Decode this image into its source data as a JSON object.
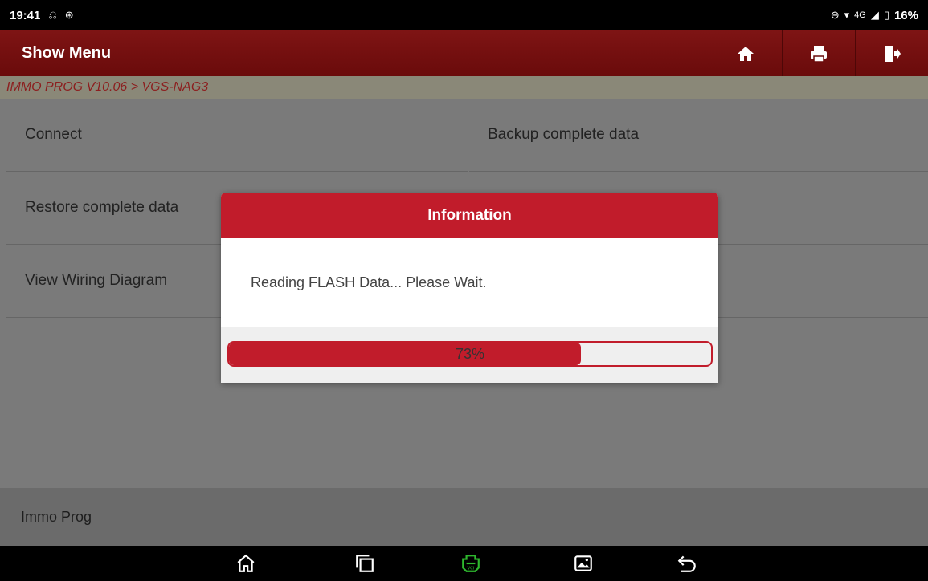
{
  "status_bar": {
    "time": "19:41",
    "network": "4G",
    "battery": "16%"
  },
  "header": {
    "title": "Show Menu",
    "buttons": [
      {
        "icon": "home-icon"
      },
      {
        "icon": "print-icon"
      },
      {
        "icon": "exit-icon"
      }
    ]
  },
  "breadcrumb": "IMMO PROG V10.06 > VGS-NAG3",
  "menu": {
    "items": [
      {
        "label": "Connect"
      },
      {
        "label": "Backup complete data"
      },
      {
        "label": "Restore complete data"
      },
      {
        "label": "View Wiring Diagram"
      }
    ]
  },
  "footer": {
    "label": "Immo Prog"
  },
  "dialog": {
    "title": "Information",
    "message": "Reading FLASH Data... Please Wait.",
    "progress_text": "73%",
    "progress_fraction": 0.73
  },
  "navbar": {
    "icons": [
      "home-icon",
      "recents-icon",
      "vci-icon",
      "screenshot-icon",
      "back-icon"
    ],
    "vci_color": "#2eb82e"
  },
  "colors": {
    "accent": "#c11c2b",
    "header": "#7e1414"
  }
}
